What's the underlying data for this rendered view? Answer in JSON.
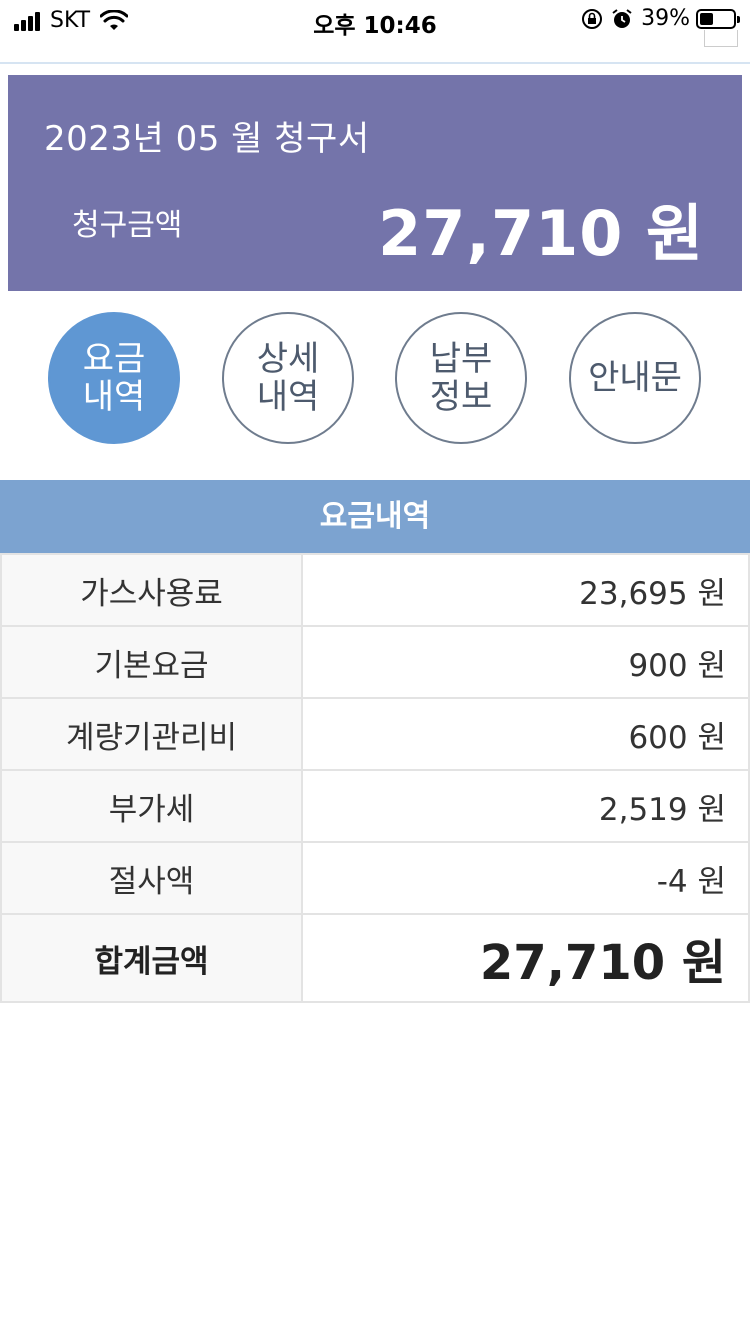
{
  "status_bar": {
    "carrier": "SKT",
    "time": "오후 10:46",
    "battery": "39%"
  },
  "bill": {
    "title": "2023년 05 월 청구서",
    "amount_label": "청구금액",
    "amount": "27,710 원"
  },
  "tabs": [
    {
      "label": "요금\n내역",
      "active": true
    },
    {
      "label": "상세\n내역",
      "active": false
    },
    {
      "label": "납부\n정보",
      "active": false
    },
    {
      "label": "안내문",
      "active": false
    }
  ],
  "section_title": "요금내역",
  "fees": [
    {
      "item": "가스사용료",
      "value": "23,695 원"
    },
    {
      "item": "기본요금",
      "value": "900 원"
    },
    {
      "item": "계량기관리비",
      "value": "600 원"
    },
    {
      "item": "부가세",
      "value": "2,519 원"
    },
    {
      "item": "절사액",
      "value": "-4 원"
    }
  ],
  "total": {
    "item": "합계금액",
    "value": "27,710 원"
  },
  "colors": {
    "card_bg": "#7474aa",
    "active_tab": "#5f97d3",
    "section_header": "#7ca3d0"
  }
}
